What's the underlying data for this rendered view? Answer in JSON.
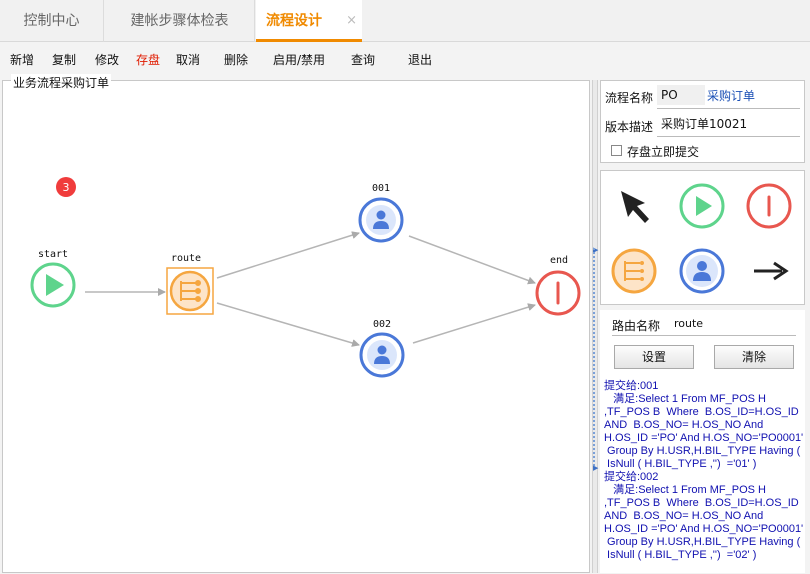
{
  "tabs": [
    {
      "label": "控制中心"
    },
    {
      "label": "建帐步骤体检表"
    },
    {
      "label": "流程设计",
      "close": "×"
    }
  ],
  "toolbar": {
    "items": [
      {
        "label": "新增"
      },
      {
        "label": "复制"
      },
      {
        "label": "修改"
      },
      {
        "label": "存盘"
      },
      {
        "label": "取消"
      },
      {
        "label": "删除"
      },
      {
        "label": "启用/禁用"
      },
      {
        "label": "查询"
      },
      {
        "label": "退出"
      }
    ]
  },
  "canvas": {
    "title": "业务流程采购订单",
    "badge": "3",
    "nodes": {
      "start": "start",
      "route": "route",
      "n001": "001",
      "n002": "002",
      "end": "end"
    }
  },
  "props": {
    "name_label": "流程名称",
    "name_value": "PO",
    "name_link": "采购订单",
    "version_label": "版本描述",
    "version_value": "采购订单10021",
    "submit_label": "存盘立即提交"
  },
  "route": {
    "name_label": "路由名称",
    "name_value": "route",
    "set_button": "设置",
    "clear_button": "清除",
    "rule_text": "提交给:001\n   满足:Select 1 From MF_POS H\n,TF_POS B  Where  B.OS_ID=H.OS_ID\nAND  B.OS_NO= H.OS_NO And\nH.OS_ID ='PO' And H.OS_NO='PO0001'\n Group By H.USR,H.BIL_TYPE Having (\n IsNull ( H.BIL_TYPE ,'')  ='01' )\n提交给:002\n   满足:Select 1 From MF_POS H\n,TF_POS B  Where  B.OS_ID=H.OS_ID\nAND  B.OS_NO= H.OS_NO And\nH.OS_ID ='PO' And H.OS_NO='PO0001'\n Group By H.USR,H.BIL_TYPE Having (\n IsNull ( H.BIL_TYPE ,'')  ='02' )"
  },
  "colors": {
    "accent": "#f08a00",
    "start_green": "#5ed48c",
    "end_red": "#e8574f",
    "user_blue": "#4a78d8",
    "route_orange": "#f5a640",
    "rule_text": "#1010b0"
  },
  "icons": {
    "palette": [
      "pointer-arrow-icon",
      "start-node-icon",
      "end-node-icon",
      "route-node-icon",
      "user-node-icon",
      "connector-arrow-icon"
    ]
  }
}
